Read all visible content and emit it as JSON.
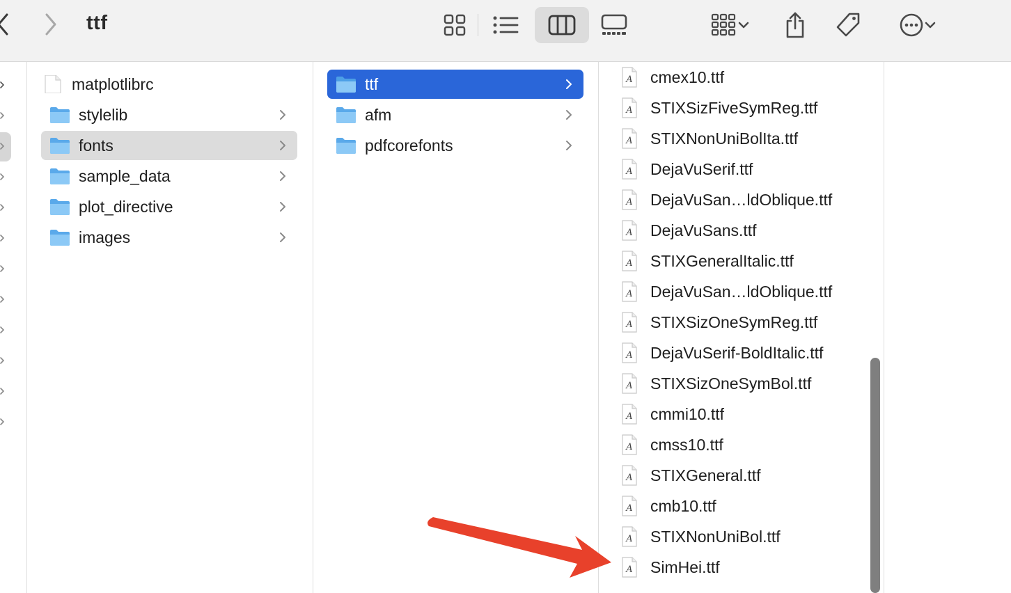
{
  "window": {
    "title": "ttf"
  },
  "toolbar": {
    "back_icon": "chevron-left-icon",
    "forward_icon": "chevron-right-icon",
    "views": [
      "icon-view",
      "list-view",
      "column-view",
      "gallery-view"
    ],
    "selected_view": "column-view"
  },
  "column1": {
    "items": [
      {
        "label": "matplotlibrc",
        "type": "file"
      },
      {
        "label": "stylelib",
        "type": "folder"
      },
      {
        "label": "fonts",
        "type": "folder",
        "highlighted": true
      },
      {
        "label": "sample_data",
        "type": "folder"
      },
      {
        "label": "plot_directive",
        "type": "folder"
      },
      {
        "label": "images",
        "type": "folder"
      }
    ]
  },
  "column2": {
    "items": [
      {
        "label": "ttf",
        "type": "folder",
        "selected": true
      },
      {
        "label": "afm",
        "type": "folder"
      },
      {
        "label": "pdfcorefonts",
        "type": "folder"
      }
    ]
  },
  "column3": {
    "items": [
      "cmex10.ttf",
      "STIXSizFiveSymReg.ttf",
      "STIXNonUniBolIta.ttf",
      "DejaVuSerif.ttf",
      "DejaVuSan…ldOblique.ttf",
      "DejaVuSans.ttf",
      "STIXGeneralItalic.ttf",
      "DejaVuSan…ldOblique.ttf",
      "STIXSizOneSymReg.ttf",
      "DejaVuSerif-BoldItalic.ttf",
      "STIXSizOneSymBol.ttf",
      "cmmi10.ttf",
      "cmss10.ttf",
      "STIXGeneral.ttf",
      "cmb10.ttf",
      "STIXNonUniBol.ttf",
      "SimHei.ttf"
    ]
  },
  "colors": {
    "selection": "#2a66d9",
    "highlight": "#dcdcdc",
    "folder": "#6cb6f0",
    "annotation_arrow": "#e8412b"
  }
}
